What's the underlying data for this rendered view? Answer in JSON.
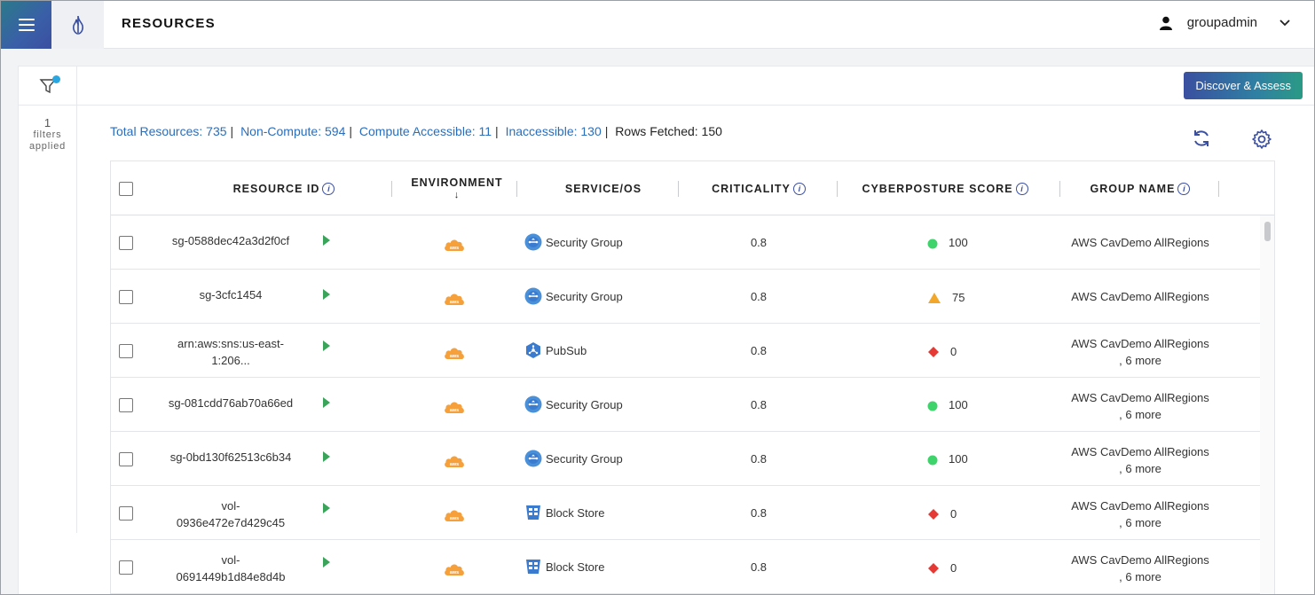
{
  "header": {
    "title": "RESOURCES",
    "user_name": "groupadmin"
  },
  "sidebar": {
    "filter_count": "1",
    "filter_label_1": "filters",
    "filter_label_2": "applied"
  },
  "toolbar": {
    "discover_label": "Discover & Assess"
  },
  "summary": {
    "total": "Total Resources: 735",
    "non_compute": "Non-Compute: 594",
    "compute_accessible": "Compute Accessible: 11",
    "inaccessible": "Inaccessible: 130",
    "rows_fetched": "Rows Fetched: 150"
  },
  "table": {
    "columns": {
      "resource_id": "RESOURCE ID",
      "environment": "ENVIRONMENT",
      "service_os": "SERVICE/OS",
      "criticality": "CRITICALITY",
      "score": "CYBERPOSTURE SCORE",
      "group": "GROUP NAME"
    },
    "rows": [
      {
        "id1": "sg-0588dec42a3d2f0cf",
        "id2": "",
        "env": "aws",
        "service": "Security Group",
        "service_icon": "security-group-icon",
        "criticality": "0.8",
        "score_icon": "green-circle",
        "score": "100",
        "group1": "AWS CavDemo AllRegions",
        "group2": ""
      },
      {
        "id1": "sg-3cfc1454",
        "id2": "",
        "env": "aws",
        "service": "Security Group",
        "service_icon": "security-group-icon",
        "criticality": "0.8",
        "score_icon": "orange-triangle",
        "score": "75",
        "group1": "AWS CavDemo AllRegions",
        "group2": ""
      },
      {
        "id1": "arn:aws:sns:us-east-",
        "id2": "1:206...",
        "env": "aws",
        "service": "PubSub",
        "service_icon": "pubsub-icon",
        "criticality": "0.8",
        "score_icon": "red-diamond",
        "score": "0",
        "group1": "AWS CavDemo AllRegions",
        "group2": ", 6 more"
      },
      {
        "id1": "sg-081cdd76ab70a66ed",
        "id2": "",
        "env": "aws",
        "service": "Security Group",
        "service_icon": "security-group-icon",
        "criticality": "0.8",
        "score_icon": "green-circle",
        "score": "100",
        "group1": "AWS CavDemo AllRegions",
        "group2": ", 6 more"
      },
      {
        "id1": "sg-0bd130f62513c6b34",
        "id2": "",
        "env": "aws",
        "service": "Security Group",
        "service_icon": "security-group-icon",
        "criticality": "0.8",
        "score_icon": "green-circle",
        "score": "100",
        "group1": "AWS CavDemo AllRegions",
        "group2": ", 6 more"
      },
      {
        "id1": "vol-",
        "id2": "0936e472e7d429c45",
        "env": "aws",
        "service": "Block Store",
        "service_icon": "block-store-icon",
        "criticality": "0.8",
        "score_icon": "red-diamond",
        "score": "0",
        "group1": "AWS CavDemo AllRegions",
        "group2": ", 6 more"
      },
      {
        "id1": "vol-",
        "id2": "0691449b1d84e8d4b",
        "env": "aws",
        "service": "Block Store",
        "service_icon": "block-store-icon",
        "criticality": "0.8",
        "score_icon": "red-diamond",
        "score": "0",
        "group1": "AWS CavDemo AllRegions",
        "group2": ", 6 more"
      }
    ]
  },
  "colors": {
    "link": "#2a6ebb",
    "score_good": "#3fd46b",
    "score_warn": "#f2a72b",
    "score_bad": "#e53935",
    "aws_orange": "#f5a03a"
  }
}
